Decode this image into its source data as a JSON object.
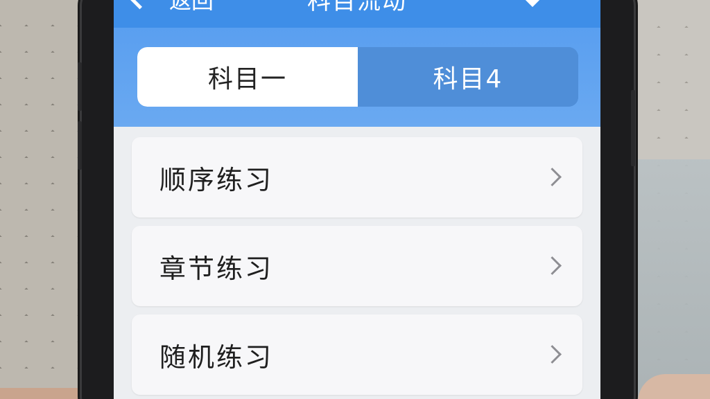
{
  "header": {
    "title": "科目流动",
    "back_label": "返回"
  },
  "tabs": [
    {
      "label": "科目一",
      "active": true
    },
    {
      "label": "科目4",
      "active": false
    }
  ],
  "list": {
    "items": [
      {
        "label": "顺序练习"
      },
      {
        "label": "章节练习"
      },
      {
        "label": "随机练习"
      }
    ]
  },
  "colors": {
    "header_blue": "#3e8ee8",
    "tab_bar_blue": "#5a9ff0",
    "tab_inactive_blue": "#4f8ed8",
    "row_background": "#f7f7f9",
    "chevron_gray": "#8e8e93"
  }
}
